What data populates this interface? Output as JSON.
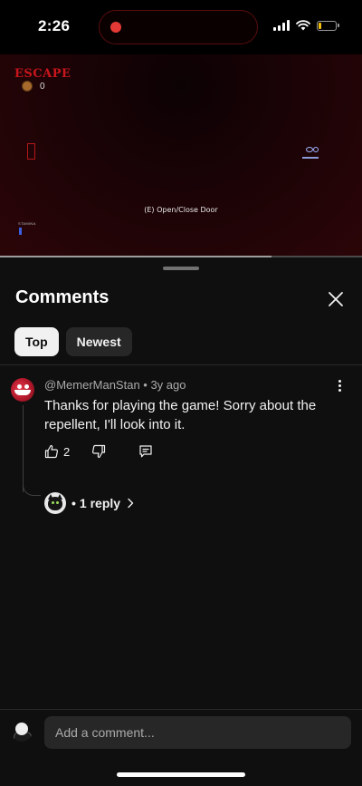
{
  "status_bar": {
    "time": "2:26",
    "battery_level_fraction": 0.2,
    "battery_color": "#f4c20d",
    "recording_color": "#e53935"
  },
  "video": {
    "game_title": "ESCAPE",
    "cookie_count": "0",
    "hint_text": "(E) Open/Close Door",
    "stamina_label": "STAMINA",
    "progress_fraction": 0.75,
    "title_color": "#c9161c"
  },
  "comments": {
    "title": "Comments",
    "close_icon": "close-icon",
    "tabs": [
      {
        "label": "Top",
        "active": true
      },
      {
        "label": "Newest",
        "active": false
      }
    ],
    "items": [
      {
        "author": "@MemerManStan",
        "age": "3y ago",
        "meta": "@MemerManStan • 3y ago",
        "text": "Thanks for playing the game! Sorry about the repellent, I'll look into it.",
        "likes": "2",
        "reply_label": "1 reply",
        "icons": [
          "thumbs-up-icon",
          "thumbs-down-icon",
          "reply-icon",
          "more-vertical-icon",
          "chevron-right-icon"
        ]
      }
    ],
    "input_placeholder": "Add a comment..."
  },
  "colors": {
    "sheet_bg": "#0f0f0f",
    "chip_active_bg": "#f1f1f1",
    "chip_inactive_bg": "#272727",
    "secondary_text": "#aaaaaa"
  }
}
